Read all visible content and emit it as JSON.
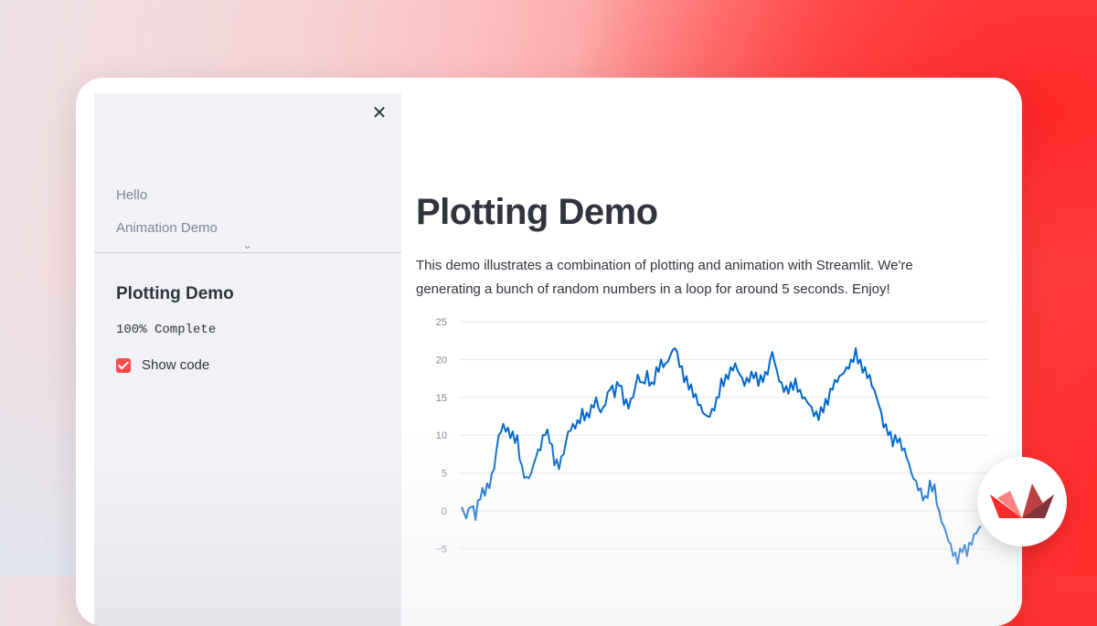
{
  "sidebar": {
    "nav_items": [
      {
        "label": "Hello"
      },
      {
        "label": "Animation Demo"
      }
    ],
    "title": "Plotting Demo",
    "progress_text": "100% Complete",
    "progress_fraction": 1.0,
    "show_code": {
      "label": "Show code",
      "checked": true
    }
  },
  "main": {
    "title": "Plotting Demo",
    "description": "This demo illustrates a combination of plotting and animation with Streamlit. We're generating a bunch of random numbers in a loop for around 5 seconds. Enjoy!"
  },
  "icons": {
    "close": "close-icon",
    "chevron": "chevron-down-icon",
    "checkbox": "checkmark-icon",
    "logo": "streamlit-logo-icon"
  },
  "colors": {
    "accent": "#ff4b4b",
    "line": "#0068c9",
    "text": "#31333f",
    "muted": "#808495"
  },
  "chart_data": {
    "type": "line",
    "yticks": [
      25,
      20,
      15,
      10,
      5,
      0,
      -5
    ],
    "ylim": [
      -7,
      25
    ],
    "series": [
      {
        "values": [
          0.5,
          -1,
          0.5,
          -1.2,
          1.5,
          2,
          3,
          5.5,
          10,
          11.5,
          11,
          10.5,
          10,
          6,
          4.5,
          5,
          7,
          8,
          10,
          9,
          6,
          5.5,
          7.5,
          10.5,
          11.5,
          12,
          13.5,
          13,
          14,
          15,
          13,
          14,
          16,
          15,
          16.5,
          14,
          13.5,
          15,
          18,
          17,
          18.5,
          17,
          19,
          20,
          19.5,
          20.5,
          21.5,
          19,
          17,
          16,
          15,
          14,
          13,
          12.5,
          13.5,
          15,
          17.5,
          18,
          19,
          19.5,
          18,
          16.5,
          17,
          17.5,
          16.5,
          17,
          18,
          21,
          18.5,
          17,
          16.5,
          17,
          17.5,
          16,
          15,
          14,
          12.5,
          12,
          13,
          14,
          16,
          17,
          18,
          19,
          20,
          21.5,
          20,
          19,
          18,
          16,
          14,
          11,
          10,
          8.5,
          9,
          8,
          7,
          5,
          4,
          3,
          2,
          4,
          3.5,
          0,
          -2,
          -4,
          -6,
          -7,
          -5.5,
          -6,
          -4.5,
          -3,
          -2
        ]
      }
    ]
  }
}
